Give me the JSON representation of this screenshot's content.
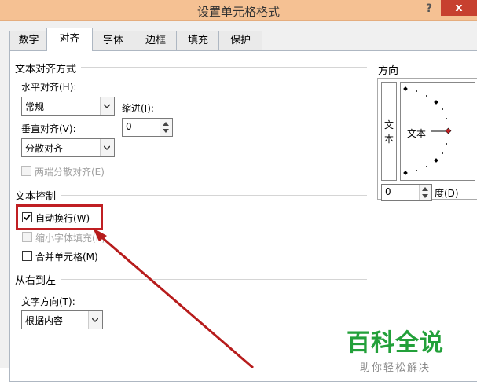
{
  "window": {
    "title": "设置单元格格式",
    "help_icon": "?",
    "close_icon": "x"
  },
  "tabs": [
    {
      "label": "数字"
    },
    {
      "label": "对齐"
    },
    {
      "label": "字体"
    },
    {
      "label": "边框"
    },
    {
      "label": "填充"
    },
    {
      "label": "保护"
    }
  ],
  "text_alignment": {
    "group_title": "文本对齐方式",
    "horizontal_label": "水平对齐(H):",
    "horizontal_value": "常规",
    "indent_label": "缩进(I):",
    "indent_value": "0",
    "vertical_label": "垂直对齐(V):",
    "vertical_value": "分散对齐",
    "justify_distributed_label": "两端分散对齐(E)"
  },
  "text_control": {
    "group_title": "文本控制",
    "wrap_text_label": "自动换行(W)",
    "wrap_text_checked": true,
    "shrink_to_fit_label": "缩小字体填充(K)",
    "merge_cells_label": "合并单元格(M)"
  },
  "rtl": {
    "group_title": "从右到左",
    "direction_label": "文字方向(T):",
    "direction_value": "根据内容"
  },
  "orientation": {
    "group_title": "方向",
    "vertical_text": "文本",
    "dial_text": "文本",
    "degree_value": "0",
    "degree_label": "度(D)"
  },
  "watermark": {
    "logo": "百科全说",
    "subtitle": "助你轻松解决"
  },
  "colors": {
    "titlebar": "#f5c193",
    "close": "#c7402f",
    "highlight": "#c01f23",
    "watermark_green": "#23a03a"
  }
}
